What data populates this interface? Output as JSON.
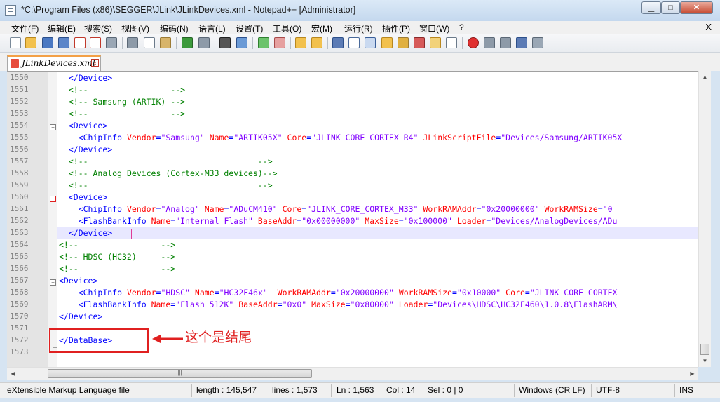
{
  "window": {
    "title": "*C:\\Program Files (x86)\\SEGGER\\JLink\\JLinkDevices.xml - Notepad++ [Administrator]",
    "min_glyph": "▁",
    "max_glyph": "□",
    "close_glyph": "✕"
  },
  "menu": {
    "items": [
      "文件(F)",
      "编辑(E)",
      "搜索(S)",
      "视图(V)",
      "编码(N)",
      "语言(L)",
      "设置(T)",
      "工具(O)",
      "宏(M)",
      "运行(R)",
      "插件(P)",
      "窗口(W)",
      "?"
    ],
    "close": "X"
  },
  "tab": {
    "label": "JLinkDevices.xml",
    "close_glyph": "x"
  },
  "editor": {
    "lines": [
      {
        "num": "1550",
        "parts": [
          [
            "t-txt",
            "  "
          ],
          [
            "t-tag",
            "</Device>"
          ]
        ]
      },
      {
        "num": "1551",
        "parts": [
          [
            "t-txt",
            "  "
          ],
          [
            "t-cmt",
            "<!--                 -->"
          ]
        ]
      },
      {
        "num": "1552",
        "parts": [
          [
            "t-txt",
            "  "
          ],
          [
            "t-cmt",
            "<!-- Samsung (ARTIK) -->"
          ]
        ]
      },
      {
        "num": "1553",
        "parts": [
          [
            "t-txt",
            "  "
          ],
          [
            "t-cmt",
            "<!--                 -->"
          ]
        ]
      },
      {
        "num": "1554",
        "parts": [
          [
            "t-txt",
            "  "
          ],
          [
            "t-tag",
            "<Device>"
          ]
        ]
      },
      {
        "num": "1555",
        "parts": [
          [
            "t-txt",
            "    "
          ],
          [
            "t-tag",
            "<ChipInfo "
          ],
          [
            "t-attr",
            "Vendor"
          ],
          [
            "t-tag",
            "="
          ],
          [
            "t-val",
            "\"Samsung\""
          ],
          [
            "t-tag",
            " "
          ],
          [
            "t-attr",
            "Name"
          ],
          [
            "t-tag",
            "="
          ],
          [
            "t-val",
            "\"ARTIK05X\""
          ],
          [
            "t-tag",
            " "
          ],
          [
            "t-attr",
            "Core"
          ],
          [
            "t-tag",
            "="
          ],
          [
            "t-val",
            "\"JLINK_CORE_CORTEX_R4\""
          ],
          [
            "t-tag",
            " "
          ],
          [
            "t-attr",
            "JLinkScriptFile"
          ],
          [
            "t-tag",
            "="
          ],
          [
            "t-val",
            "\"Devices/Samsung/ARTIK05X"
          ]
        ]
      },
      {
        "num": "1556",
        "parts": [
          [
            "t-txt",
            "  "
          ],
          [
            "t-tag",
            "</Device>"
          ]
        ]
      },
      {
        "num": "1557",
        "parts": [
          [
            "t-txt",
            "  "
          ],
          [
            "t-cmt",
            "<!--                                   -->"
          ]
        ]
      },
      {
        "num": "1558",
        "parts": [
          [
            "t-txt",
            "  "
          ],
          [
            "t-cmt",
            "<!-- Analog Devices (Cortex-M33 devices)-->"
          ]
        ]
      },
      {
        "num": "1559",
        "parts": [
          [
            "t-txt",
            "  "
          ],
          [
            "t-cmt",
            "<!--                                   -->"
          ]
        ]
      },
      {
        "num": "1560",
        "parts": [
          [
            "t-txt",
            "  "
          ],
          [
            "t-tag",
            "<Device>"
          ]
        ]
      },
      {
        "num": "1561",
        "parts": [
          [
            "t-txt",
            "    "
          ],
          [
            "t-tag",
            "<ChipInfo "
          ],
          [
            "t-attr",
            "Vendor"
          ],
          [
            "t-tag",
            "="
          ],
          [
            "t-val",
            "\"Analog\""
          ],
          [
            "t-tag",
            " "
          ],
          [
            "t-attr",
            "Name"
          ],
          [
            "t-tag",
            "="
          ],
          [
            "t-val",
            "\"ADuCM410\""
          ],
          [
            "t-tag",
            " "
          ],
          [
            "t-attr",
            "Core"
          ],
          [
            "t-tag",
            "="
          ],
          [
            "t-val",
            "\"JLINK_CORE_CORTEX_M33\""
          ],
          [
            "t-tag",
            " "
          ],
          [
            "t-attr",
            "WorkRAMAddr"
          ],
          [
            "t-tag",
            "="
          ],
          [
            "t-val",
            "\"0x20000000\""
          ],
          [
            "t-tag",
            " "
          ],
          [
            "t-attr",
            "WorkRAMSize"
          ],
          [
            "t-tag",
            "="
          ],
          [
            "t-val",
            "\"0"
          ]
        ]
      },
      {
        "num": "1562",
        "parts": [
          [
            "t-txt",
            "    "
          ],
          [
            "t-tag",
            "<FlashBankInfo "
          ],
          [
            "t-attr",
            "Name"
          ],
          [
            "t-tag",
            "="
          ],
          [
            "t-val",
            "\"Internal Flash\""
          ],
          [
            "t-tag",
            " "
          ],
          [
            "t-attr",
            "BaseAddr"
          ],
          [
            "t-tag",
            "="
          ],
          [
            "t-val",
            "\"0x00000000\""
          ],
          [
            "t-tag",
            " "
          ],
          [
            "t-attr",
            "MaxSize"
          ],
          [
            "t-tag",
            "="
          ],
          [
            "t-val",
            "\"0x100000\""
          ],
          [
            "t-tag",
            " "
          ],
          [
            "t-attr",
            "Loader"
          ],
          [
            "t-tag",
            "="
          ],
          [
            "t-val",
            "\"Devices/AnalogDevices/ADu"
          ]
        ]
      },
      {
        "num": "1563",
        "parts": [
          [
            "t-txt",
            "  "
          ],
          [
            "t-tag",
            "</Device>"
          ]
        ]
      },
      {
        "num": "1564",
        "parts": [
          [
            "t-cmt",
            "<!--                 -->"
          ]
        ]
      },
      {
        "num": "1565",
        "parts": [
          [
            "t-cmt",
            "<!-- HDSC (HC32)     -->"
          ]
        ]
      },
      {
        "num": "1566",
        "parts": [
          [
            "t-cmt",
            "<!--                 -->"
          ]
        ]
      },
      {
        "num": "1567",
        "parts": [
          [
            "t-tag",
            "<Device>"
          ]
        ]
      },
      {
        "num": "1568",
        "parts": [
          [
            "t-txt",
            "    "
          ],
          [
            "t-tag",
            "<ChipInfo "
          ],
          [
            "t-attr",
            "Vendor"
          ],
          [
            "t-tag",
            "="
          ],
          [
            "t-val",
            "\"HDSC\""
          ],
          [
            "t-tag",
            " "
          ],
          [
            "t-attr",
            "Name"
          ],
          [
            "t-tag",
            "="
          ],
          [
            "t-val",
            "\"HC32F46x\""
          ],
          [
            "t-tag",
            "  "
          ],
          [
            "t-attr",
            "WorkRAMAddr"
          ],
          [
            "t-tag",
            "="
          ],
          [
            "t-val",
            "\"0x20000000\""
          ],
          [
            "t-tag",
            " "
          ],
          [
            "t-attr",
            "WorkRAMSize"
          ],
          [
            "t-tag",
            "="
          ],
          [
            "t-val",
            "\"0x10000\""
          ],
          [
            "t-tag",
            " "
          ],
          [
            "t-attr",
            "Core"
          ],
          [
            "t-tag",
            "="
          ],
          [
            "t-val",
            "\"JLINK_CORE_CORTEX"
          ]
        ]
      },
      {
        "num": "1569",
        "parts": [
          [
            "t-txt",
            "    "
          ],
          [
            "t-tag",
            "<FlashBankInfo "
          ],
          [
            "t-attr",
            "Name"
          ],
          [
            "t-tag",
            "="
          ],
          [
            "t-val",
            "\"Flash_512K\""
          ],
          [
            "t-tag",
            " "
          ],
          [
            "t-attr",
            "BaseAddr"
          ],
          [
            "t-tag",
            "="
          ],
          [
            "t-val",
            "\"0x0\""
          ],
          [
            "t-tag",
            " "
          ],
          [
            "t-attr",
            "MaxSize"
          ],
          [
            "t-tag",
            "="
          ],
          [
            "t-val",
            "\"0x80000\""
          ],
          [
            "t-tag",
            " "
          ],
          [
            "t-attr",
            "Loader"
          ],
          [
            "t-tag",
            "="
          ],
          [
            "t-val",
            "\"Devices\\HDSC\\HC32F460\\1.0.8\\FlashARM\\"
          ]
        ]
      },
      {
        "num": "1570",
        "parts": [
          [
            "t-tag",
            "</Device>"
          ]
        ]
      },
      {
        "num": "1571",
        "parts": []
      },
      {
        "num": "1572",
        "parts": [
          [
            "t-tag",
            "</DataBase>"
          ]
        ]
      },
      {
        "num": "1573",
        "parts": []
      }
    ],
    "current_line": "1563"
  },
  "annotation": {
    "text": "这个是结尾"
  },
  "status": {
    "filetype": "eXtensible Markup Language file",
    "length": "length : 145,547",
    "lines": "lines : 1,573",
    "position": "Ln : 1,563",
    "column": "Col : 14",
    "selection": "Sel : 0 | 0",
    "eol": "Windows (CR LF)",
    "encoding": "UTF-8",
    "mode": "INS"
  },
  "colors": {
    "tag": "#0000ff",
    "comment": "#008000",
    "attribute": "#ff0000",
    "value": "#8000ff",
    "annotation": "#e02020",
    "current_line_bg": "#e8e8ff"
  }
}
